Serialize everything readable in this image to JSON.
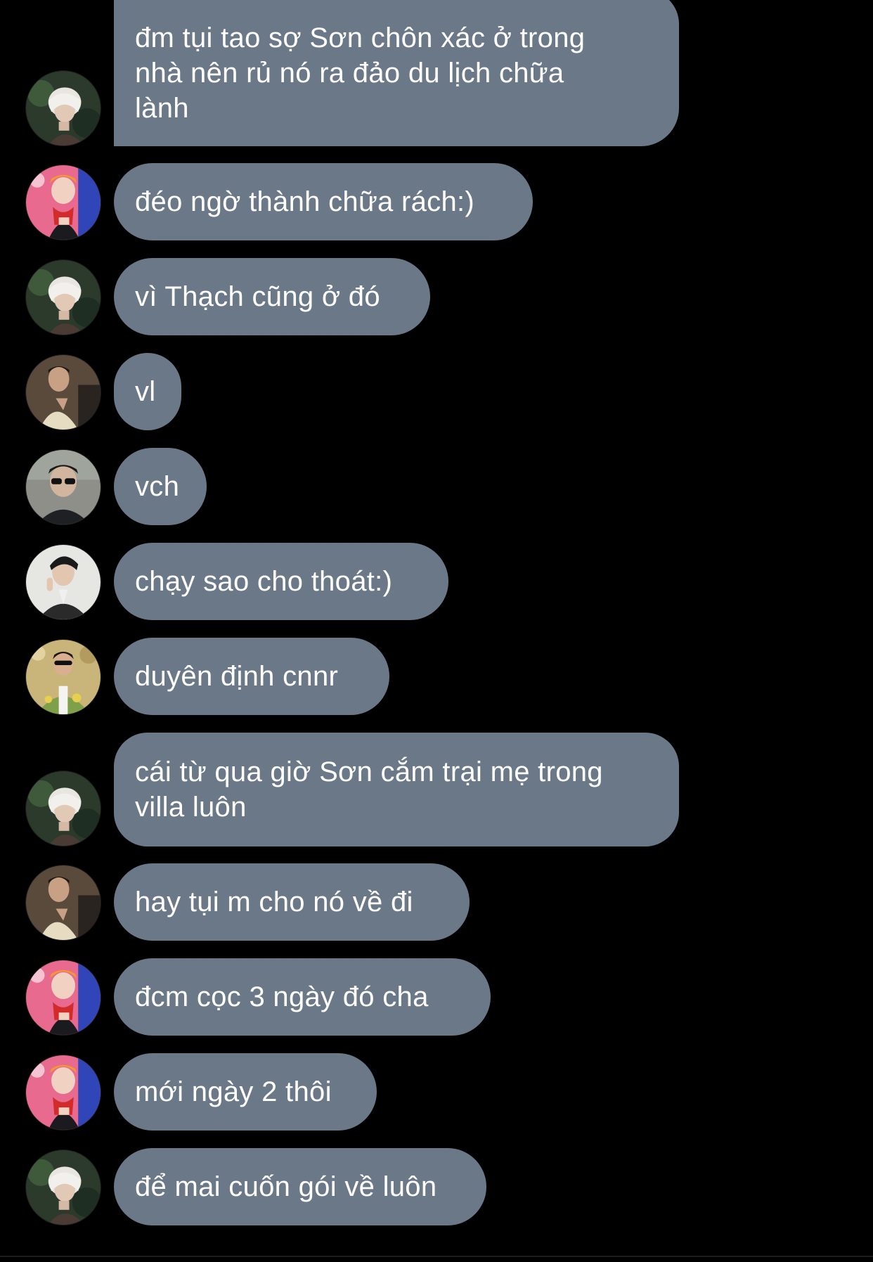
{
  "conversation": {
    "messages": [
      {
        "sender": "avatar-white-hair",
        "text": "đm tụi tao sợ Sơn chôn xác ở trong\nnhà nên rủ nó ra đảo du lịch chữa\nlành"
      },
      {
        "sender": "avatar-red-scarf",
        "text": "đéo ngờ thành chữa rách:)"
      },
      {
        "sender": "avatar-white-hair",
        "text": "vì Thạch cũng ở đó"
      },
      {
        "sender": "avatar-beige-shirt",
        "text": "vl"
      },
      {
        "sender": "avatar-sunglasses",
        "text": "vch"
      },
      {
        "sender": "avatar-suit",
        "text": "chạy sao cho thoát:)"
      },
      {
        "sender": "avatar-floral-shirt",
        "text": "duyên định cnnr"
      },
      {
        "sender": "avatar-white-hair",
        "text": "cái từ qua giờ Sơn cắm trại mẹ trong\nvilla luôn"
      },
      {
        "sender": "avatar-beige-shirt",
        "text": "hay tụi m cho nó về đi"
      },
      {
        "sender": "avatar-red-scarf",
        "text": "đcm cọc 3 ngày đó cha"
      },
      {
        "sender": "avatar-red-scarf",
        "text": "mới ngày 2 thôi"
      },
      {
        "sender": "avatar-white-hair",
        "text": "để mai cuốn gói về luôn"
      }
    ]
  },
  "colors": {
    "background": "#000000",
    "bubble": "#6b7887",
    "text": "#ffffff"
  }
}
